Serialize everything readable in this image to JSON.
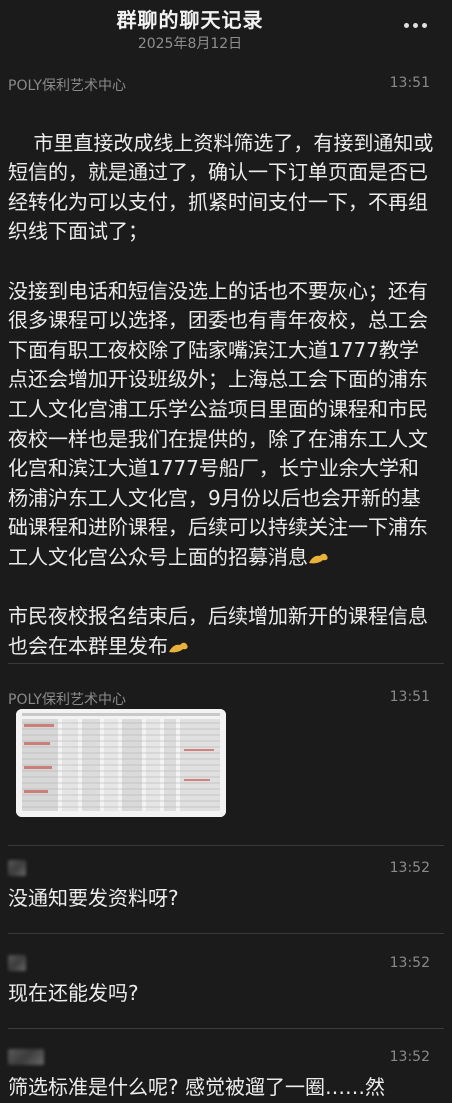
{
  "header": {
    "title": "群聊的聊天记录",
    "date": "2025年8月12日",
    "more_icon": "more-dots-icon"
  },
  "messages": [
    {
      "sender": "POLY保利艺术中心",
      "time": "13:51",
      "text": "市里直接改成线上资料筛选了，有接到通知或短信的，就是通过了，确认一下订单页面是否已经转化为可以支付，抓紧时间支付一下，不再组织线下面试了；\n\n没接到电话和短信没选上的话也不要灰心；还有很多课程可以选择，团委也有青年夜校，总工会下面有职工夜校除了陆家嘴滨江大道1777教学点还会增加开设班级外；上海总工会下面的浦东工人文化宫浦工乐学公益项目里面的课程和市民夜校一样也是我们在提供的，除了在浦东工人文化宫和滨江大道1777号船厂，长宁业余大学和杨浦沪东工人文化宫，9月份以后也会开新的基础课程和进阶课程，后续可以持续关注一下浦东工人文化宫公众号上面的招募消息",
      "text2": "市民夜校报名结束后，后续增加新开的课程信息也会在本群里发布",
      "emoji": "strong-arm-emoji"
    },
    {
      "sender": "POLY保利艺术中心",
      "time": "13:51",
      "attachment": "spreadsheet-image-thumbnail"
    },
    {
      "time": "13:52",
      "text": "没通知要发资料呀?"
    },
    {
      "time": "13:52",
      "text": "现在还能发吗?"
    },
    {
      "time": "13:52",
      "text": "筛选标准是什么呢? 感觉被遛了一圈……然"
    }
  ],
  "colors": {
    "background": "#1b1b1b",
    "text": "#ececec",
    "muted": "#8a8a8a",
    "divider": "#3a3a3a",
    "emoji": "#e8b23a"
  }
}
